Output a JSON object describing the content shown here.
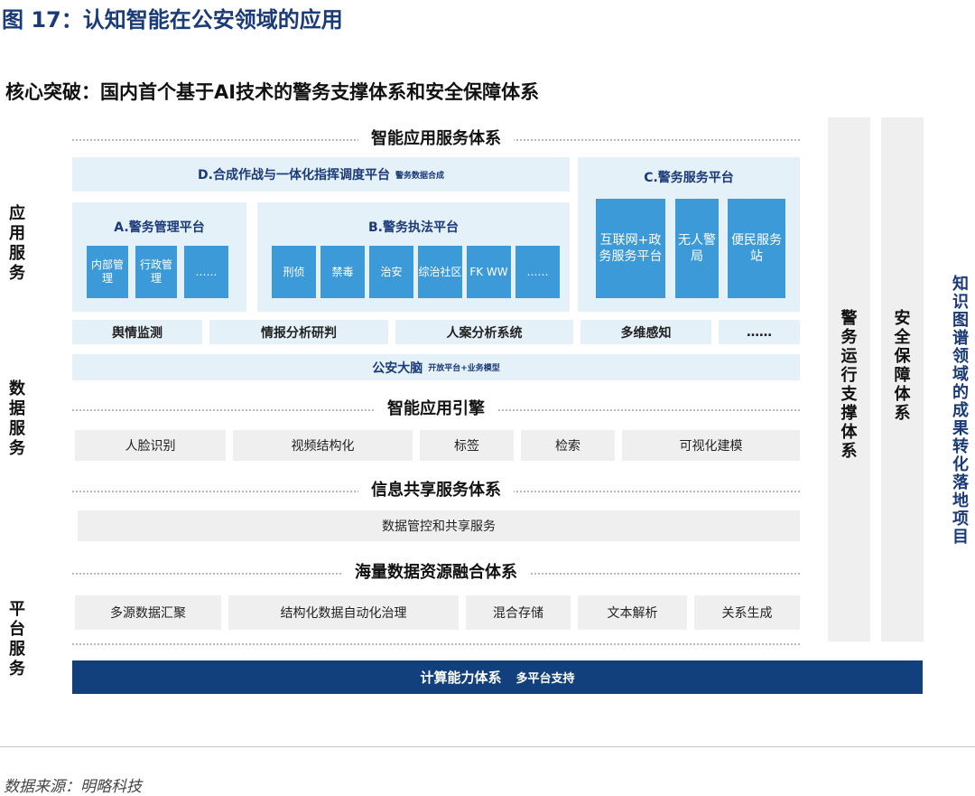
{
  "figure": {
    "number": "图 17：",
    "title": "认知智能在公安领域的应用",
    "subtitle": "核心突破：国内首个基于AI技术的警务支撑体系和安全保障体系"
  },
  "side_labels": {
    "app": "应用服务",
    "data": "数据服务",
    "platform": "平台服务",
    "right": "知识图谱领域的成果转化落地项目"
  },
  "sections": {
    "s1": "智能应用服务体系",
    "s2": "智能应用引擎",
    "s3": "信息共享服务体系",
    "s4": "海量数据资源融合体系"
  },
  "panel_d": {
    "title": "D.合成作战与一体化指挥调度平台",
    "note": "警务数据合成"
  },
  "panel_c": {
    "title": "C.警务服务平台",
    "tiles": [
      "互联网+政务服务平台",
      "无人警局",
      "便民服务站"
    ]
  },
  "panel_a": {
    "title": "A.警务管理平台",
    "tiles": [
      "内部管理",
      "行政管理",
      "……"
    ]
  },
  "panel_b": {
    "title": "B.警务执法平台",
    "tiles": [
      "刑侦",
      "禁毒",
      "治安",
      "综治社区",
      "FK WW",
      "……"
    ]
  },
  "analysis_row": [
    "舆情监测",
    "情报分析研判",
    "人案分析系统",
    "多维感知",
    "……"
  ],
  "brain": {
    "title": "公安大脑",
    "note": "开放平台+业务模型"
  },
  "engine_row": [
    "人脸识别",
    "视频结构化",
    "标签",
    "检索",
    "可视化建模"
  ],
  "sharing": "数据管控和共享服务",
  "fusion_row": [
    "多源数据汇聚",
    "结构化数据自动化治理",
    "混合存储",
    "文本解析",
    "关系生成"
  ],
  "pillars": [
    "警务运行支撑体系",
    "安全保障体系"
  ],
  "compute": {
    "title": "计算能力体系",
    "note": "多平台支持"
  },
  "source": "数据来源：明略科技",
  "colors": {
    "navy": "#12407c",
    "tile_blue": "#3d9ad8",
    "light_blue": "#e5f1f9",
    "gray": "#efefef"
  }
}
